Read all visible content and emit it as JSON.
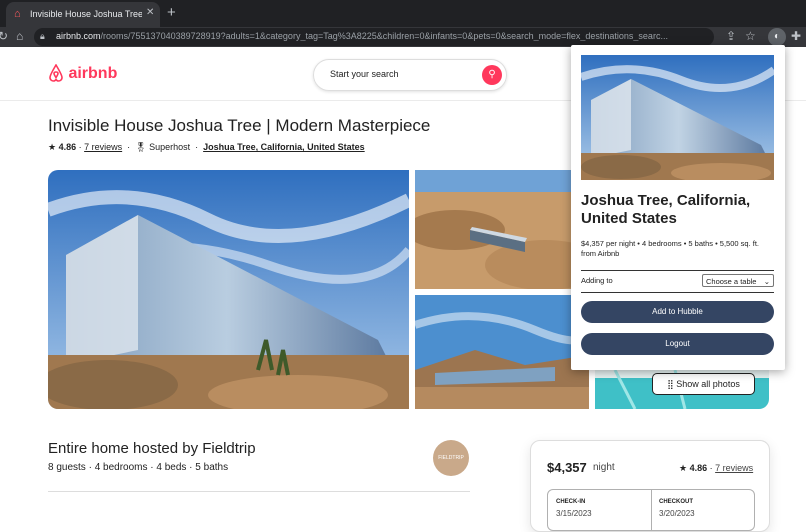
{
  "browser": {
    "tab_title": "Invisible House Joshua Tree | M",
    "url_host": "airbnb.com",
    "url_path": "/rooms/755137040389728919?adults=1&category_tag=Tag%3A8225&children=0&infants=0&pets=0&search_mode=flex_destinations_searc..."
  },
  "header": {
    "brand": "airbnb",
    "search_placeholder": "Start your search"
  },
  "listing": {
    "title": "Invisible House Joshua Tree | Modern Masterpiece",
    "rating": "4.86",
    "reviews": "7 reviews",
    "host_badge": "Superhost",
    "location": "Joshua Tree, California, United States",
    "show_photos": "Show all photos"
  },
  "host": {
    "title": "Entire home hosted by Fieldtrip",
    "details": "8 guests · 4 bedrooms · 4 beds · 5 baths",
    "avatar_text": "FIELDTRIP"
  },
  "booking": {
    "price": "$4,357",
    "per": "night",
    "rating": "4.86",
    "reviews": "7 reviews",
    "checkin_label": "CHECK-IN",
    "checkin_value": "3/15/2023",
    "checkout_label": "CHECKOUT",
    "checkout_value": "3/20/2023"
  },
  "extension": {
    "location": "Joshua Tree, California, United States",
    "details_line1": "$4,357 per night • 4 bedrooms • 5 baths • 5,500 sq. ft.",
    "details_line2": "from Airbnb",
    "adding_to_label": "Adding to",
    "select_value": "Choose a table",
    "add_button": "Add to Hubble",
    "logout_button": "Logout"
  },
  "colors": {
    "brand": "#ff385c",
    "button": "#344563"
  }
}
